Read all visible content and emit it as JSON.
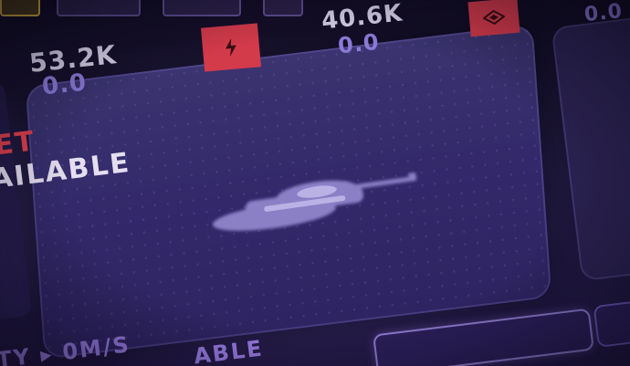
{
  "stats": {
    "top_right_value": "0.0",
    "stat_a_value": "53.2K",
    "stat_a_sub": "0.0",
    "stat_b_value": "40.6K",
    "stat_b_sub": "0.0"
  },
  "icons": {
    "stat_a_badge": "lightning-icon",
    "stat_b_badge": "diamond-icon"
  },
  "panel": {
    "status_red_partial": "ET",
    "status_white_partial": "AILABLE"
  },
  "bottom": {
    "speed_label_partial": "TY ▸ 0M/S",
    "status_partial": "ABLE"
  },
  "colors": {
    "accent_red": "#d33a4a",
    "accent_purple": "#8c7ad8",
    "panel_bg": "#362c6c"
  }
}
